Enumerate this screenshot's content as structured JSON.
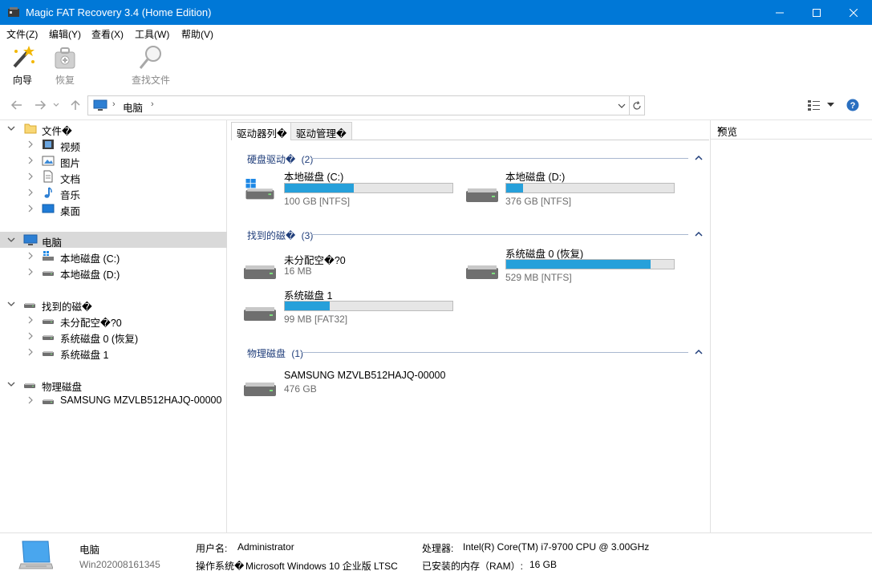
{
  "window": {
    "title": "Magic FAT Recovery 3.4 (Home Edition)",
    "accent_color": "#0078d7"
  },
  "menu": [
    "文件(Z)",
    "编辑(Y)",
    "查看(X)",
    "工具(W)",
    "帮助(V)"
  ],
  "toolbar": {
    "wizard": "向导",
    "recover": "恢复",
    "find_files": "查找文件"
  },
  "address": {
    "crumb": "电脑"
  },
  "tree": {
    "files": {
      "label": "文件�",
      "children": [
        "视频",
        "图片",
        "文档",
        "音乐",
        "桌面"
      ]
    },
    "computer": {
      "label": "电脑",
      "children": [
        "本地磁盘 (C:)",
        "本地磁盘 (D:)"
      ]
    },
    "found": {
      "label": "找到的磁�",
      "children": [
        "未分配空�?0",
        "系统磁盘 0 (恢复)",
        "系统磁盘 1"
      ]
    },
    "physical": {
      "label": "物理磁盘",
      "children": [
        "SAMSUNG MZVLB512HAJQ-00000"
      ]
    }
  },
  "tabs": [
    "驱动器列�",
    "驱动管理�"
  ],
  "groups": {
    "hdd": {
      "label": "硬盘驱动�",
      "count": "(2)",
      "drives": [
        {
          "name": "本地磁盘 (C:)",
          "info": "100 GB [NTFS]",
          "usage": 0.41,
          "icon": "windows-drive-icon"
        },
        {
          "name": "本地磁盘 (D:)",
          "info": "376 GB [NTFS]",
          "usage": 0.1,
          "icon": "hard-drive-icon"
        }
      ]
    },
    "found": {
      "label": "找到的磁�",
      "count": "(3)",
      "drives": [
        {
          "name": "未分配空�?0",
          "info": "16 MB",
          "usage": null,
          "icon": "hard-drive-icon"
        },
        {
          "name": "系统磁盘 0 (恢复)",
          "info": "529 MB [NTFS]",
          "usage": 0.86,
          "icon": "hard-drive-icon"
        },
        {
          "name": "系统磁盘 1",
          "info": "99 MB [FAT32]",
          "usage": 0.27,
          "icon": "hard-drive-icon"
        }
      ]
    },
    "physical": {
      "label": "物理磁盘",
      "count": "(1)",
      "drives": [
        {
          "name": "SAMSUNG MZVLB512HAJQ-00000",
          "info": "476 GB",
          "usage": null,
          "icon": "hard-drive-icon"
        }
      ]
    }
  },
  "preview": {
    "title": "预览",
    "close": "×"
  },
  "details": {
    "name": "电脑",
    "host": "Win202008161345",
    "user_label": "用户名:",
    "user_value": "Administrator",
    "os_label": "操作系统�",
    "os_value": "Microsoft Windows 10 企业版 LTSC",
    "cpu_label": "处理器:",
    "cpu_value": "Intel(R) Core(TM) i7-9700 CPU @ 3.00GHz",
    "ram_label": "已安装的内存（RAM）:",
    "ram_value": "16 GB"
  },
  "colors": {
    "usage_bar": "#26a0da",
    "group_header": "#1f3d7a",
    "selection": "#d9d9d9"
  }
}
